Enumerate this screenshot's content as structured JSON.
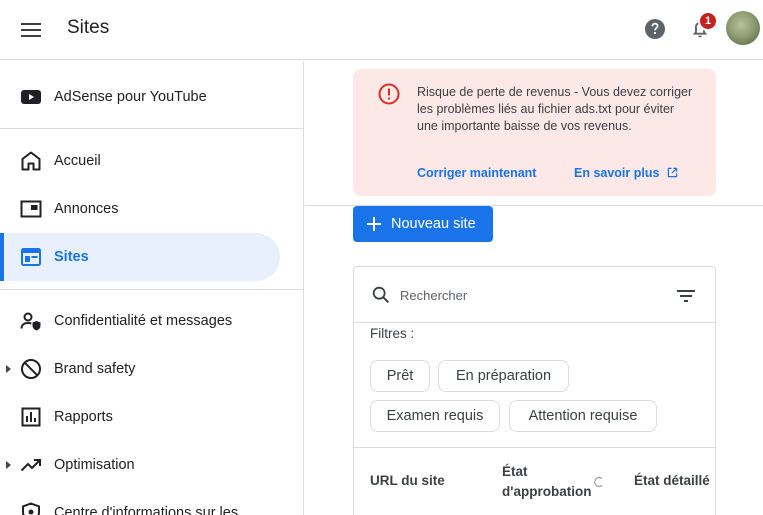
{
  "header": {
    "title": "Sites",
    "notification_count": "1"
  },
  "sidebar": {
    "items": [
      {
        "label": "AdSense pour YouTube",
        "icon": "youtube-icon"
      },
      {
        "label": "Accueil",
        "icon": "home-icon"
      },
      {
        "label": "Annonces",
        "icon": "ads-icon"
      },
      {
        "label": "Sites",
        "icon": "sites-icon",
        "active": true
      },
      {
        "label": "Confidentialité et messages",
        "icon": "privacy-user-icon"
      },
      {
        "label": "Brand safety",
        "icon": "block-icon"
      },
      {
        "label": "Rapports",
        "icon": "reports-icon"
      },
      {
        "label": "Optimisation",
        "icon": "trending-up-icon"
      },
      {
        "label": "Centre d'informations sur les",
        "icon": "policy-icon"
      }
    ]
  },
  "alert": {
    "text": "Risque de perte de revenus - Vous devez corriger les problèmes liés au fichier ads.txt pour éviter une importante baisse de vos revenus.",
    "fix_link": "Corriger maintenant",
    "learn_link": "En savoir plus"
  },
  "actions": {
    "new_site": "Nouveau site"
  },
  "search": {
    "placeholder": "Rechercher"
  },
  "filters": {
    "label": "Filtres :",
    "chips": [
      "Prêt",
      "En préparation",
      "Examen requis",
      "Attention requise"
    ]
  },
  "table": {
    "columns": [
      "URL du site",
      "État d'approbation",
      "État détaillé"
    ]
  },
  "colors": {
    "accent": "#1a73e8",
    "alert_bg": "#fce8e6",
    "alert_icon": "#d93025",
    "badge": "#c5221f"
  }
}
